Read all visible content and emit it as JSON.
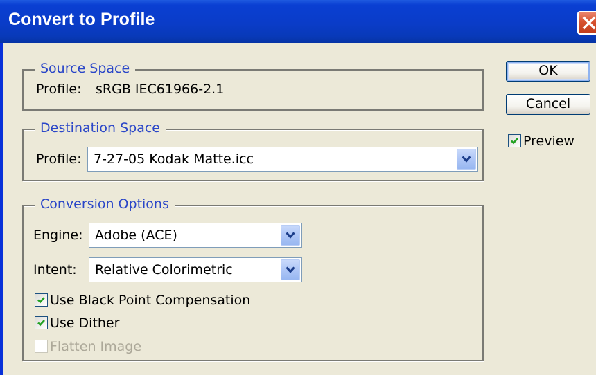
{
  "window": {
    "title": "Convert to Profile"
  },
  "source_space": {
    "legend": "Source Space",
    "profile_label": "Profile:",
    "profile_value": "sRGB IEC61966-2.1"
  },
  "destination_space": {
    "legend": "Destination Space",
    "profile_label": "Profile:",
    "profile_value": "7-27-05 Kodak Matte.icc"
  },
  "conversion_options": {
    "legend": "Conversion Options",
    "engine_label": "Engine:",
    "engine_value": "Adobe (ACE)",
    "intent_label": "Intent:",
    "intent_value": "Relative Colorimetric",
    "black_point": {
      "label": "Use Black Point Compensation",
      "checked": true
    },
    "dither": {
      "label": "Use Dither",
      "checked": true
    },
    "flatten": {
      "label": "Flatten Image",
      "checked": false,
      "disabled": true
    }
  },
  "buttons": {
    "ok": "OK",
    "cancel": "Cancel"
  },
  "preview": {
    "label": "Preview",
    "checked": true
  },
  "colors": {
    "titlebar": "#0a3cc8",
    "legend_text": "#2a46c8",
    "dialog_bg": "#ece9d8",
    "close_button": "#d6512f"
  }
}
